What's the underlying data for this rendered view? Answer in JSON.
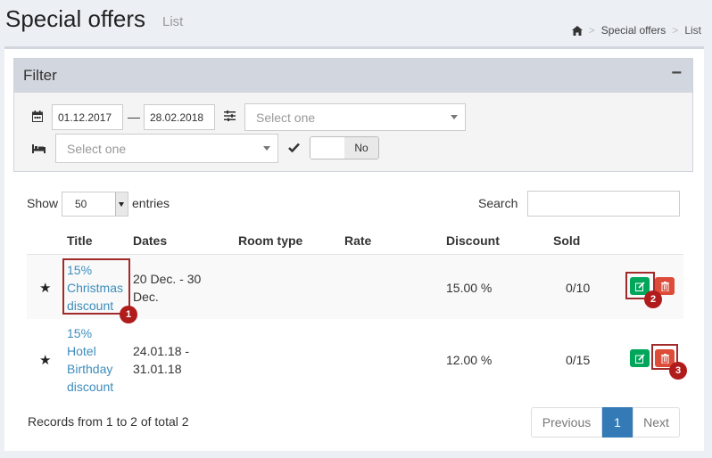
{
  "header": {
    "title": "Special offers",
    "subtitle": "List"
  },
  "breadcrumb": {
    "home_icon": "home-icon",
    "items": [
      "Special offers",
      "List"
    ]
  },
  "filter": {
    "title": "Filter",
    "collapse": "−",
    "date_from": "01.12.2017",
    "date_sep": "—",
    "date_to": "28.02.2018",
    "rate_placeholder": "Select one",
    "room_placeholder": "Select one",
    "toggle_label": "No"
  },
  "table": {
    "show_label": "Show",
    "entries_value": "50",
    "entries_label": "entries",
    "search_label": "Search",
    "columns": [
      "Title",
      "Dates",
      "Room type",
      "Rate",
      "Discount",
      "Sold"
    ],
    "rows": [
      {
        "title": [
          "15%",
          "Christmas",
          "discount"
        ],
        "dates": [
          "20 Dec. - 30",
          "Dec."
        ],
        "room_type": "",
        "rate": "",
        "discount": "15.00 %",
        "sold": "0/10"
      },
      {
        "title": [
          "15%",
          "Hotel",
          "Birthday",
          "discount"
        ],
        "dates": [
          "24.01.18 -",
          "31.01.18"
        ],
        "room_type": "",
        "rate": "",
        "discount": "12.00 %",
        "sold": "0/15"
      }
    ],
    "records_text": "Records from 1 to 2 of total 2"
  },
  "pagination": {
    "previous": "Previous",
    "current": "1",
    "next": "Next"
  },
  "annotations": [
    "1",
    "2",
    "3"
  ],
  "colors": {
    "edit": "#00a65a",
    "delete": "#dd4b39",
    "link": "#3c8dbc",
    "badge": "#b01c1c"
  }
}
